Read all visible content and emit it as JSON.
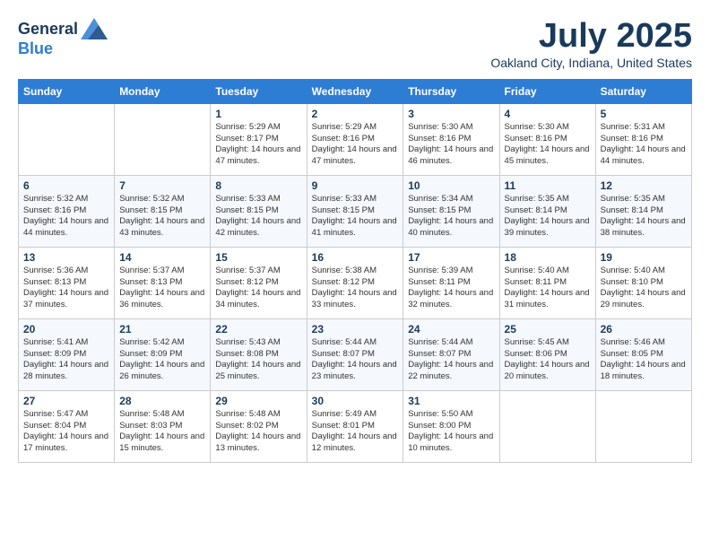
{
  "header": {
    "logo_general": "General",
    "logo_blue": "Blue",
    "month_title": "July 2025",
    "location": "Oakland City, Indiana, United States"
  },
  "calendar": {
    "columns": [
      "Sunday",
      "Monday",
      "Tuesday",
      "Wednesday",
      "Thursday",
      "Friday",
      "Saturday"
    ],
    "weeks": [
      [
        {
          "day": "",
          "content": ""
        },
        {
          "day": "",
          "content": ""
        },
        {
          "day": "1",
          "content": "Sunrise: 5:29 AM\nSunset: 8:17 PM\nDaylight: 14 hours\nand 47 minutes."
        },
        {
          "day": "2",
          "content": "Sunrise: 5:29 AM\nSunset: 8:16 PM\nDaylight: 14 hours\nand 47 minutes."
        },
        {
          "day": "3",
          "content": "Sunrise: 5:30 AM\nSunset: 8:16 PM\nDaylight: 14 hours\nand 46 minutes."
        },
        {
          "day": "4",
          "content": "Sunrise: 5:30 AM\nSunset: 8:16 PM\nDaylight: 14 hours\nand 45 minutes."
        },
        {
          "day": "5",
          "content": "Sunrise: 5:31 AM\nSunset: 8:16 PM\nDaylight: 14 hours\nand 44 minutes."
        }
      ],
      [
        {
          "day": "6",
          "content": "Sunrise: 5:32 AM\nSunset: 8:16 PM\nDaylight: 14 hours\nand 44 minutes."
        },
        {
          "day": "7",
          "content": "Sunrise: 5:32 AM\nSunset: 8:15 PM\nDaylight: 14 hours\nand 43 minutes."
        },
        {
          "day": "8",
          "content": "Sunrise: 5:33 AM\nSunset: 8:15 PM\nDaylight: 14 hours\nand 42 minutes."
        },
        {
          "day": "9",
          "content": "Sunrise: 5:33 AM\nSunset: 8:15 PM\nDaylight: 14 hours\nand 41 minutes."
        },
        {
          "day": "10",
          "content": "Sunrise: 5:34 AM\nSunset: 8:15 PM\nDaylight: 14 hours\nand 40 minutes."
        },
        {
          "day": "11",
          "content": "Sunrise: 5:35 AM\nSunset: 8:14 PM\nDaylight: 14 hours\nand 39 minutes."
        },
        {
          "day": "12",
          "content": "Sunrise: 5:35 AM\nSunset: 8:14 PM\nDaylight: 14 hours\nand 38 minutes."
        }
      ],
      [
        {
          "day": "13",
          "content": "Sunrise: 5:36 AM\nSunset: 8:13 PM\nDaylight: 14 hours\nand 37 minutes."
        },
        {
          "day": "14",
          "content": "Sunrise: 5:37 AM\nSunset: 8:13 PM\nDaylight: 14 hours\nand 36 minutes."
        },
        {
          "day": "15",
          "content": "Sunrise: 5:37 AM\nSunset: 8:12 PM\nDaylight: 14 hours\nand 34 minutes."
        },
        {
          "day": "16",
          "content": "Sunrise: 5:38 AM\nSunset: 8:12 PM\nDaylight: 14 hours\nand 33 minutes."
        },
        {
          "day": "17",
          "content": "Sunrise: 5:39 AM\nSunset: 8:11 PM\nDaylight: 14 hours\nand 32 minutes."
        },
        {
          "day": "18",
          "content": "Sunrise: 5:40 AM\nSunset: 8:11 PM\nDaylight: 14 hours\nand 31 minutes."
        },
        {
          "day": "19",
          "content": "Sunrise: 5:40 AM\nSunset: 8:10 PM\nDaylight: 14 hours\nand 29 minutes."
        }
      ],
      [
        {
          "day": "20",
          "content": "Sunrise: 5:41 AM\nSunset: 8:09 PM\nDaylight: 14 hours\nand 28 minutes."
        },
        {
          "day": "21",
          "content": "Sunrise: 5:42 AM\nSunset: 8:09 PM\nDaylight: 14 hours\nand 26 minutes."
        },
        {
          "day": "22",
          "content": "Sunrise: 5:43 AM\nSunset: 8:08 PM\nDaylight: 14 hours\nand 25 minutes."
        },
        {
          "day": "23",
          "content": "Sunrise: 5:44 AM\nSunset: 8:07 PM\nDaylight: 14 hours\nand 23 minutes."
        },
        {
          "day": "24",
          "content": "Sunrise: 5:44 AM\nSunset: 8:07 PM\nDaylight: 14 hours\nand 22 minutes."
        },
        {
          "day": "25",
          "content": "Sunrise: 5:45 AM\nSunset: 8:06 PM\nDaylight: 14 hours\nand 20 minutes."
        },
        {
          "day": "26",
          "content": "Sunrise: 5:46 AM\nSunset: 8:05 PM\nDaylight: 14 hours\nand 18 minutes."
        }
      ],
      [
        {
          "day": "27",
          "content": "Sunrise: 5:47 AM\nSunset: 8:04 PM\nDaylight: 14 hours\nand 17 minutes."
        },
        {
          "day": "28",
          "content": "Sunrise: 5:48 AM\nSunset: 8:03 PM\nDaylight: 14 hours\nand 15 minutes."
        },
        {
          "day": "29",
          "content": "Sunrise: 5:48 AM\nSunset: 8:02 PM\nDaylight: 14 hours\nand 13 minutes."
        },
        {
          "day": "30",
          "content": "Sunrise: 5:49 AM\nSunset: 8:01 PM\nDaylight: 14 hours\nand 12 minutes."
        },
        {
          "day": "31",
          "content": "Sunrise: 5:50 AM\nSunset: 8:00 PM\nDaylight: 14 hours\nand 10 minutes."
        },
        {
          "day": "",
          "content": ""
        },
        {
          "day": "",
          "content": ""
        }
      ]
    ]
  }
}
